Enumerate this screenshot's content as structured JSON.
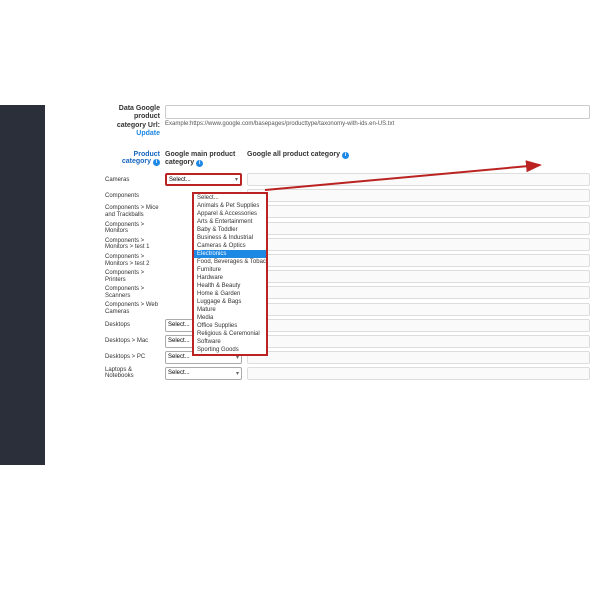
{
  "url_section": {
    "label_line1": "Data Google product",
    "label_line2": "category Url:",
    "update_link": "Update",
    "example_hint": "Example:https://www.google.com/basepages/producttype/taxonomy-with-ids.en-US.txt"
  },
  "columns": {
    "product_category": "Product category",
    "google_main": "Google main product category",
    "google_all": "Google all product category"
  },
  "rows": [
    {
      "label": "Cameras",
      "select_value": "Select..."
    },
    {
      "label": "Components",
      "select_value": ""
    },
    {
      "label": "Components > Mice and Trackballs",
      "select_value": ""
    },
    {
      "label": "Components > Monitors",
      "select_value": ""
    },
    {
      "label": "Components > Monitors > test 1",
      "select_value": ""
    },
    {
      "label": "Components > Monitors > test 2",
      "select_value": ""
    },
    {
      "label": "Components > Printers",
      "select_value": ""
    },
    {
      "label": "Components > Scanners",
      "select_value": ""
    },
    {
      "label": "Components > Web Cameras",
      "select_value": ""
    },
    {
      "label": "Desktops",
      "select_value": "Select..."
    },
    {
      "label": "Desktops > Mac",
      "select_value": "Select..."
    },
    {
      "label": "Desktops > PC",
      "select_value": "Select..."
    },
    {
      "label": "Laptops & Notebooks",
      "select_value": "Select..."
    }
  ],
  "dropdown_options": [
    "Select...",
    "Animals & Pet Supplies",
    "Apparel & Accessories",
    "Arts & Entertainment",
    "Baby & Toddler",
    "Business & Industrial",
    "Cameras & Optics",
    "Electronics",
    "Food, Beverages & Tobacco",
    "Furniture",
    "Hardware",
    "Health & Beauty",
    "Home & Garden",
    "Luggage & Bags",
    "Mature",
    "Media",
    "Office Supplies",
    "Religious & Ceremonial",
    "Software",
    "Sporting Goods"
  ],
  "highlighted_option": "Electronics"
}
